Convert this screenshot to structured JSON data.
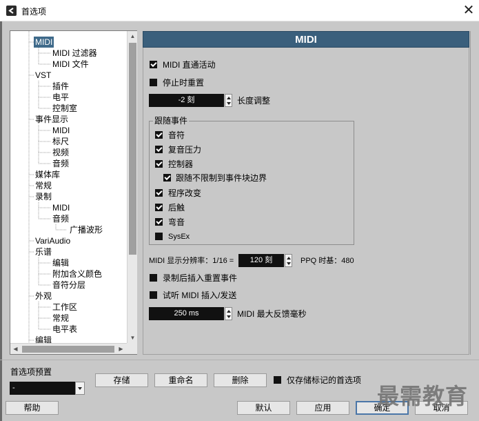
{
  "window": {
    "title": "首选项",
    "close_glyph": "✕"
  },
  "tree": {
    "items": [
      {
        "label": "MIDI",
        "level": 1,
        "selected": true
      },
      {
        "label": "MIDI 过滤器",
        "level": 2
      },
      {
        "label": "MIDI 文件",
        "level": 2
      },
      {
        "label": "VST",
        "level": 1
      },
      {
        "label": "插件",
        "level": 2
      },
      {
        "label": "电平",
        "level": 2
      },
      {
        "label": "控制室",
        "level": 2
      },
      {
        "label": "事件显示",
        "level": 1
      },
      {
        "label": "MIDI",
        "level": 2
      },
      {
        "label": "标尺",
        "level": 2
      },
      {
        "label": "视频",
        "level": 2
      },
      {
        "label": "音频",
        "level": 2
      },
      {
        "label": "媒体库",
        "level": 1
      },
      {
        "label": "常规",
        "level": 1
      },
      {
        "label": "录制",
        "level": 1
      },
      {
        "label": "MIDI",
        "level": 2
      },
      {
        "label": "音频",
        "level": 2
      },
      {
        "label": "广播波形",
        "level": 3
      },
      {
        "label": "VariAudio",
        "level": 1
      },
      {
        "label": "乐谱",
        "level": 1
      },
      {
        "label": "编辑",
        "level": 2
      },
      {
        "label": "附加含义颜色",
        "level": 2
      },
      {
        "label": "音符分层",
        "level": 2
      },
      {
        "label": "外观",
        "level": 1
      },
      {
        "label": "工作区",
        "level": 2
      },
      {
        "label": "常规",
        "level": 2
      },
      {
        "label": "电平表",
        "level": 2
      },
      {
        "label": "编辑",
        "level": 1
      }
    ]
  },
  "panel": {
    "title": "MIDI",
    "midi_thru": {
      "label": "MIDI 直通活动",
      "checked": true
    },
    "reset_on_stop": {
      "label": "停止时重置",
      "checked": false
    },
    "length_adjust": {
      "value": "-2 刻",
      "label": "长度调整"
    },
    "chase": {
      "title": "跟随事件",
      "items": [
        {
          "label": "音符",
          "checked": true
        },
        {
          "label": "复音压力",
          "checked": true
        },
        {
          "label": "控制器",
          "checked": true
        },
        {
          "label": "跟随不限制到事件块边界",
          "checked": true
        },
        {
          "label": "程序改变",
          "checked": true
        },
        {
          "label": "后触",
          "checked": true
        },
        {
          "label": "弯音",
          "checked": true
        },
        {
          "label": "SysEx",
          "checked": false
        }
      ]
    },
    "resolution": {
      "label": "MIDI 显示分辨率：1/16 =",
      "value": "120 刻",
      "ppq_label": "PPQ 时基：480"
    },
    "insert_reset": {
      "label": "录制后插入重置事件",
      "checked": false
    },
    "audition": {
      "label": "试听 MIDI 插入/发送",
      "checked": false
    },
    "max_feedback": {
      "value": "250 ms",
      "label": "MIDI 最大反馈毫秒"
    }
  },
  "presets": {
    "label": "首选项预置",
    "combo_value": "-",
    "store": "存储",
    "rename": "重命名",
    "delete": "删除",
    "only_marked": {
      "label": "仅存储标记的首选项",
      "checked": false
    }
  },
  "footer": {
    "help": "帮助",
    "defaults": "默认",
    "apply": "应用",
    "ok": "确定",
    "cancel": "取消"
  },
  "watermark": "最需教育",
  "colors": {
    "accent": "#3f6a8a",
    "header": "#3a5f7c",
    "background": "#c8c8c8"
  }
}
